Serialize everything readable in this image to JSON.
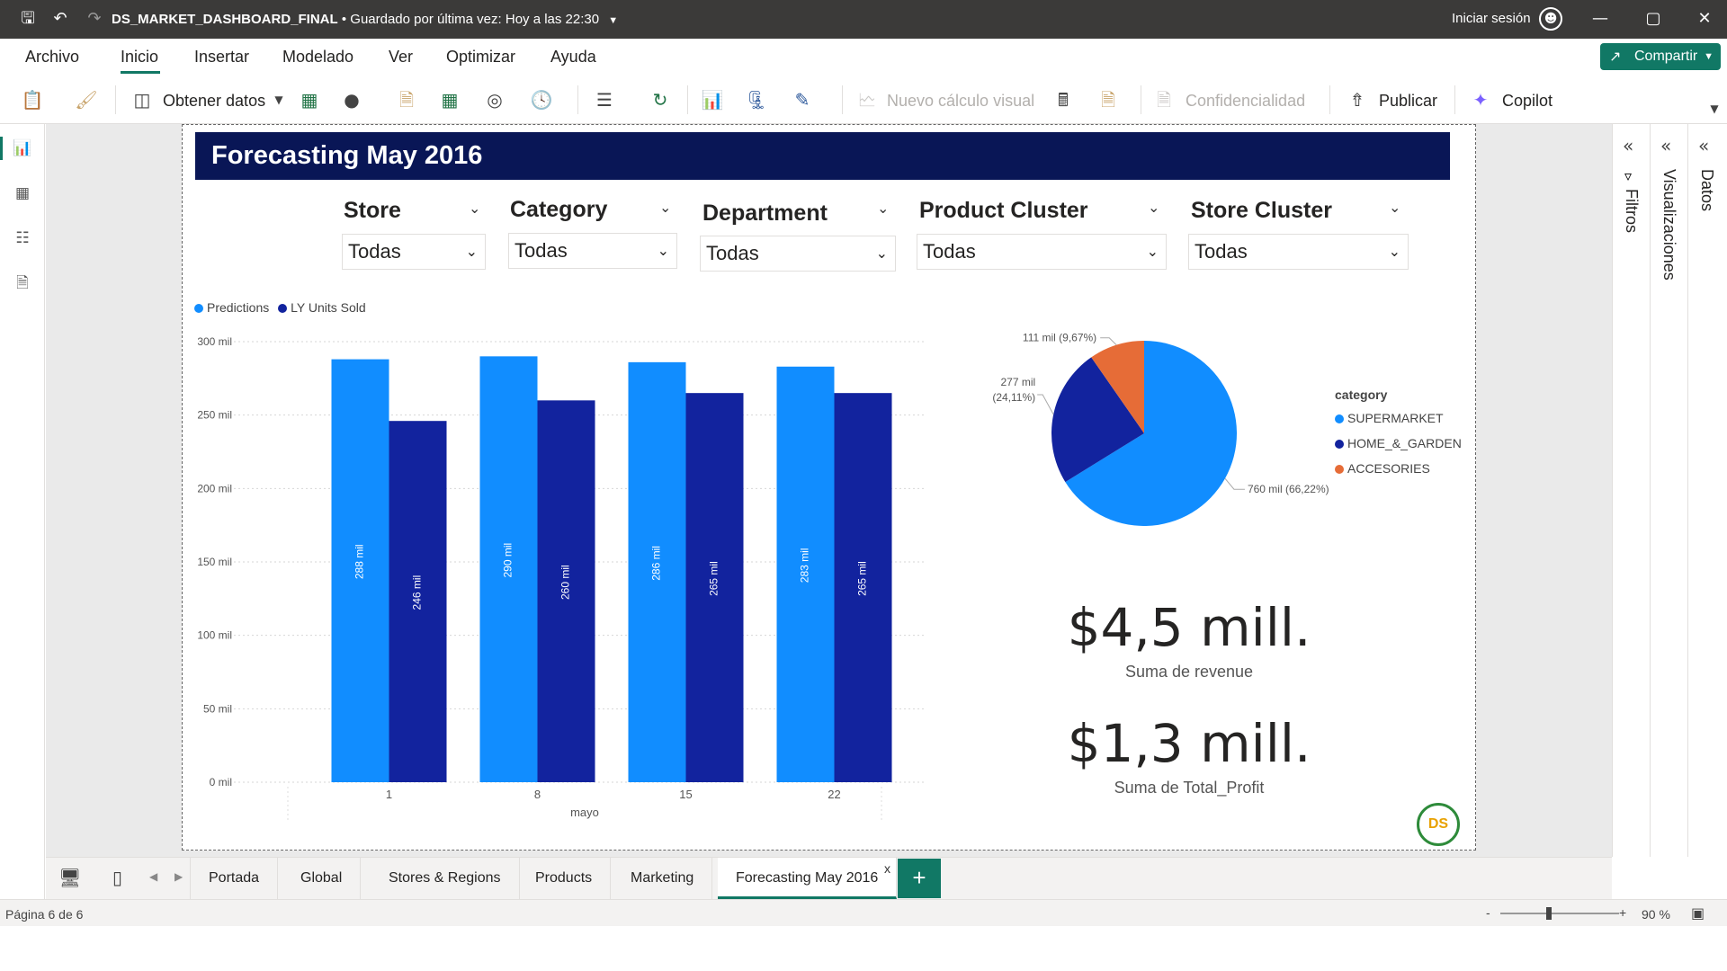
{
  "titlebar": {
    "doc_title": "DS_MARKET_DASHBOARD_FINAL",
    "saved_status": " • Guardado por última vez: Hoy a las 22:30",
    "signin": "Iniciar sesión"
  },
  "menu": {
    "items": [
      "Archivo",
      "Inicio",
      "Insertar",
      "Modelado",
      "Ver",
      "Optimizar",
      "Ayuda"
    ],
    "share": "Compartir"
  },
  "ribbon": {
    "get_data": "Obtener datos",
    "new_visual_calc": "Nuevo cálculo visual",
    "sensitivity": "Confidencialidad",
    "publish": "Publicar",
    "copilot": "Copilot"
  },
  "report": {
    "title": "Forecasting May 2016",
    "slicers": [
      {
        "label": "Store",
        "value": "Todas"
      },
      {
        "label": "Category",
        "value": "Todas"
      },
      {
        "label": "Department",
        "value": "Todas"
      },
      {
        "label": "Product Cluster",
        "value": "Todas"
      },
      {
        "label": "Store Cluster",
        "value": "Todas"
      }
    ],
    "kpis": [
      {
        "value": "$4,5 mill.",
        "label": "Suma de revenue"
      },
      {
        "value": "$1,3 mill.",
        "label": "Suma de Total_Profit"
      }
    ],
    "logo_text": "DS"
  },
  "chart_data": [
    {
      "type": "bar",
      "categories": [
        "1",
        "8",
        "15",
        "22"
      ],
      "xlabel": "mayo",
      "ylabel": "",
      "ylim": [
        0,
        300000
      ],
      "y_ticks": [
        "0 mil",
        "50 mil",
        "100 mil",
        "150 mil",
        "200 mil",
        "250 mil",
        "300 mil"
      ],
      "legend": "top-left",
      "grid": true,
      "series": [
        {
          "name": "Predictions",
          "color": "#118DFF",
          "values": [
            288000,
            290000,
            286000,
            283000
          ],
          "labels": [
            "288 mil",
            "290 mil",
            "286 mil",
            "283 mil"
          ]
        },
        {
          "name": "LY Units Sold",
          "color": "#12239E",
          "values": [
            246000,
            260000,
            265000,
            265000
          ],
          "labels": [
            "246 mil",
            "260 mil",
            "265 mil",
            "265 mil"
          ]
        }
      ]
    },
    {
      "type": "pie",
      "legend_title": "category",
      "legend": "right",
      "slices": [
        {
          "name": "SUPERMARKET",
          "value": 760000,
          "label": "760 mil (66,22%)",
          "color": "#118DFF"
        },
        {
          "name": "HOME_&_GARDEN",
          "value": 277000,
          "label": "277 mil (24,11%)",
          "label_lines": [
            "277 mil",
            "(24,11%)"
          ],
          "color": "#12239E"
        },
        {
          "name": "ACCESORIES",
          "value": 111000,
          "label": "111 mil (9,67%)",
          "color": "#E66C37"
        }
      ]
    }
  ],
  "side_panes": [
    "Filtros",
    "Visualizaciones",
    "Datos"
  ],
  "tabs": [
    "Portada",
    "Global",
    "Stores & Regions",
    "Products",
    "Marketing",
    "Forecasting May 2016"
  ],
  "status": {
    "page": "Página 6 de 6",
    "zoom": "90 %"
  }
}
